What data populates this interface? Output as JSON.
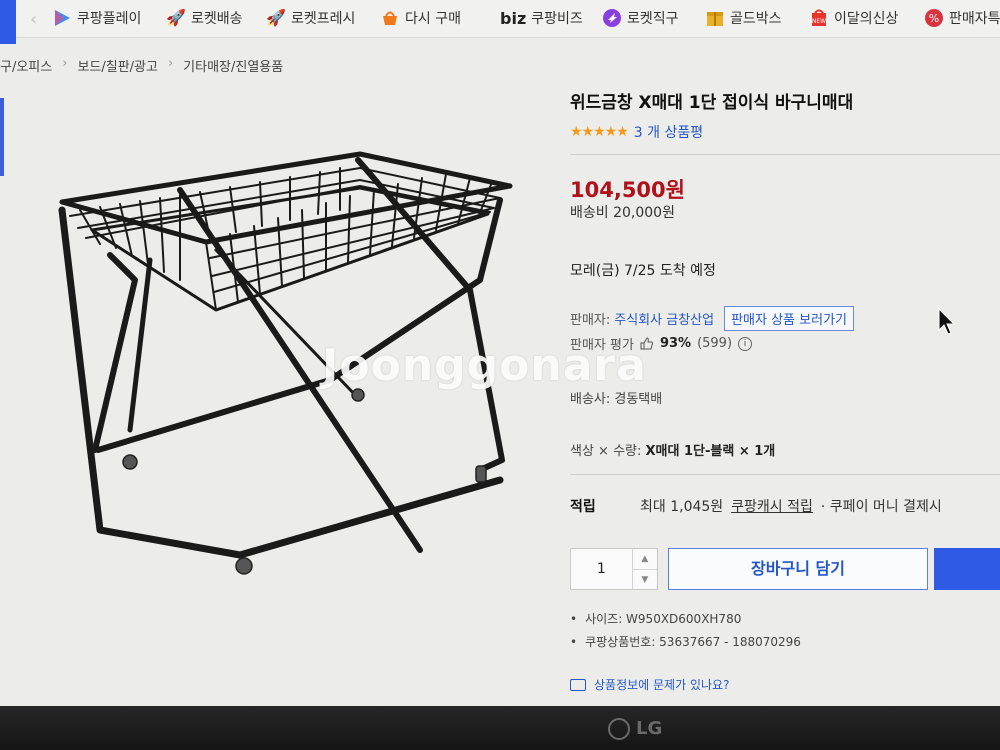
{
  "nav": {
    "items": [
      {
        "label": "쿠팡플레이",
        "icon": "play-icon"
      },
      {
        "label": "로켓배송",
        "icon": "rocket-icon"
      },
      {
        "label": "로켓프레시",
        "icon": "rocket-fresh-icon"
      },
      {
        "label": "다시 구매",
        "icon": "basket-icon"
      },
      {
        "label": "쿠팡비즈",
        "icon": "biz-icon",
        "prefix": "biz"
      },
      {
        "label": "로켓직구",
        "icon": "globe-icon"
      },
      {
        "label": "골드박스",
        "icon": "gift-box-icon"
      },
      {
        "label": "이달의신상",
        "icon": "new-badge-icon"
      },
      {
        "label": "판매자특",
        "icon": "percent-icon"
      }
    ]
  },
  "breadcrumb": [
    "구/오피스",
    "보드/칠판/광고",
    "기타매장/진열용품"
  ],
  "watermark": "Joonggonara",
  "product": {
    "title": "위드금창 X매대 1단 접이식 바구니매대",
    "rating_stars": 5,
    "review_count_text": "3 개 상품평",
    "price": "104,500원",
    "shipping_fee": "배송비 20,000원",
    "arrival": "모레(금) 7/25 도착 예정",
    "seller_label": "판매자:",
    "seller_name": "주식회사 금창산업",
    "seller_link": "판매자 상품 보러가기",
    "seller_eval_label": "판매자 평가",
    "seller_eval_pct": "93%",
    "seller_eval_count": "(599)",
    "courier": "배송사:  경동택배",
    "option_label": "색상 × 수량:",
    "option_value": "X매대 1단-블랙 × 1개",
    "points_label": "적립",
    "points_max": "최대 1,045원",
    "points_cash": "쿠팡캐시 적립",
    "points_rest": "· 쿠페이 머니 결제시",
    "quantity": "1",
    "cart_button": "장바구니 담기",
    "specs": [
      "사이즈: W950XD600XH780",
      "쿠팡상품번호: 53637667 - 188070296"
    ],
    "report_link": "상품정보에 문제가 있나요?"
  },
  "monitor_brand": "LG",
  "colors": {
    "accent_blue": "#2e5ae6",
    "price_red": "#b0121c",
    "star": "#f49b19"
  }
}
